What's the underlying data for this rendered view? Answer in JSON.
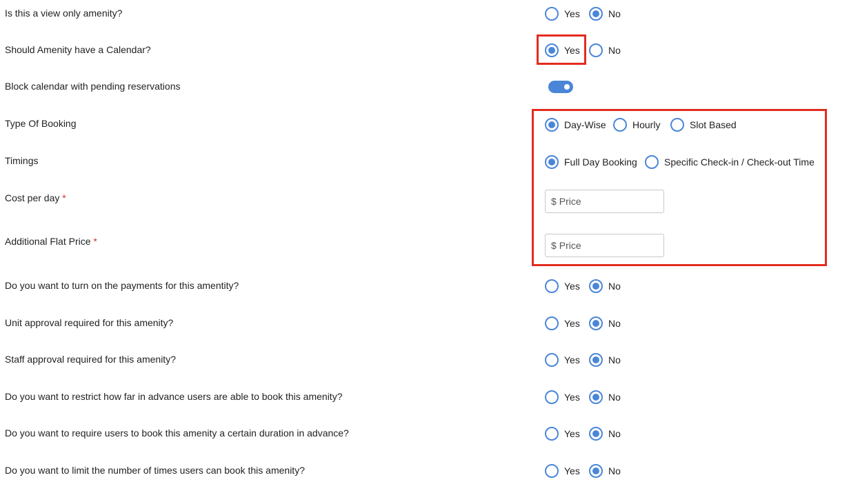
{
  "accent_color": "#4a86d8",
  "highlight_color": "#e32b1f",
  "rows": {
    "view_only": {
      "label": "Is this a view only amenity?",
      "options": [
        "Yes",
        "No"
      ],
      "selected": "No"
    },
    "calendar": {
      "label": "Should Amenity have a Calendar?",
      "options": [
        "Yes",
        "No"
      ],
      "selected": "Yes"
    },
    "block_calendar": {
      "label": "Block calendar with pending reservations",
      "toggle_on": true
    },
    "booking_type": {
      "label": "Type Of Booking",
      "options": [
        "Day-Wise",
        "Hourly",
        "Slot Based"
      ],
      "selected": "Day-Wise"
    },
    "timings": {
      "label": "Timings",
      "options": [
        "Full Day Booking",
        "Specific Check-in / Check-out Time"
      ],
      "selected": "Full Day Booking"
    },
    "cost_per_day": {
      "label": "Cost per day",
      "required_mark": "*",
      "currency": "$",
      "placeholder": "Price",
      "value": ""
    },
    "flat_price": {
      "label": "Additional Flat Price",
      "required_mark": "*",
      "currency": "$",
      "placeholder": "Price",
      "value": ""
    },
    "payments": {
      "label": "Do you want to turn on the payments for this amentity?",
      "options": [
        "Yes",
        "No"
      ],
      "selected": "No"
    },
    "unit_approval": {
      "label": "Unit approval required for this amenity?",
      "options": [
        "Yes",
        "No"
      ],
      "selected": "No"
    },
    "staff_approval": {
      "label": "Staff approval required for this amenity?",
      "options": [
        "Yes",
        "No"
      ],
      "selected": "No"
    },
    "restrict_advance": {
      "label": "Do you want to restrict how far in advance users are able to book this amenity?",
      "options": [
        "Yes",
        "No"
      ],
      "selected": "No"
    },
    "require_duration": {
      "label": "Do you want to require users to book this amenity a certain duration in advance?",
      "options": [
        "Yes",
        "No"
      ],
      "selected": "No"
    },
    "limit_times": {
      "label": "Do you want to limit the number of times users can book this amenity?",
      "options": [
        "Yes",
        "No"
      ],
      "selected": "No"
    }
  }
}
